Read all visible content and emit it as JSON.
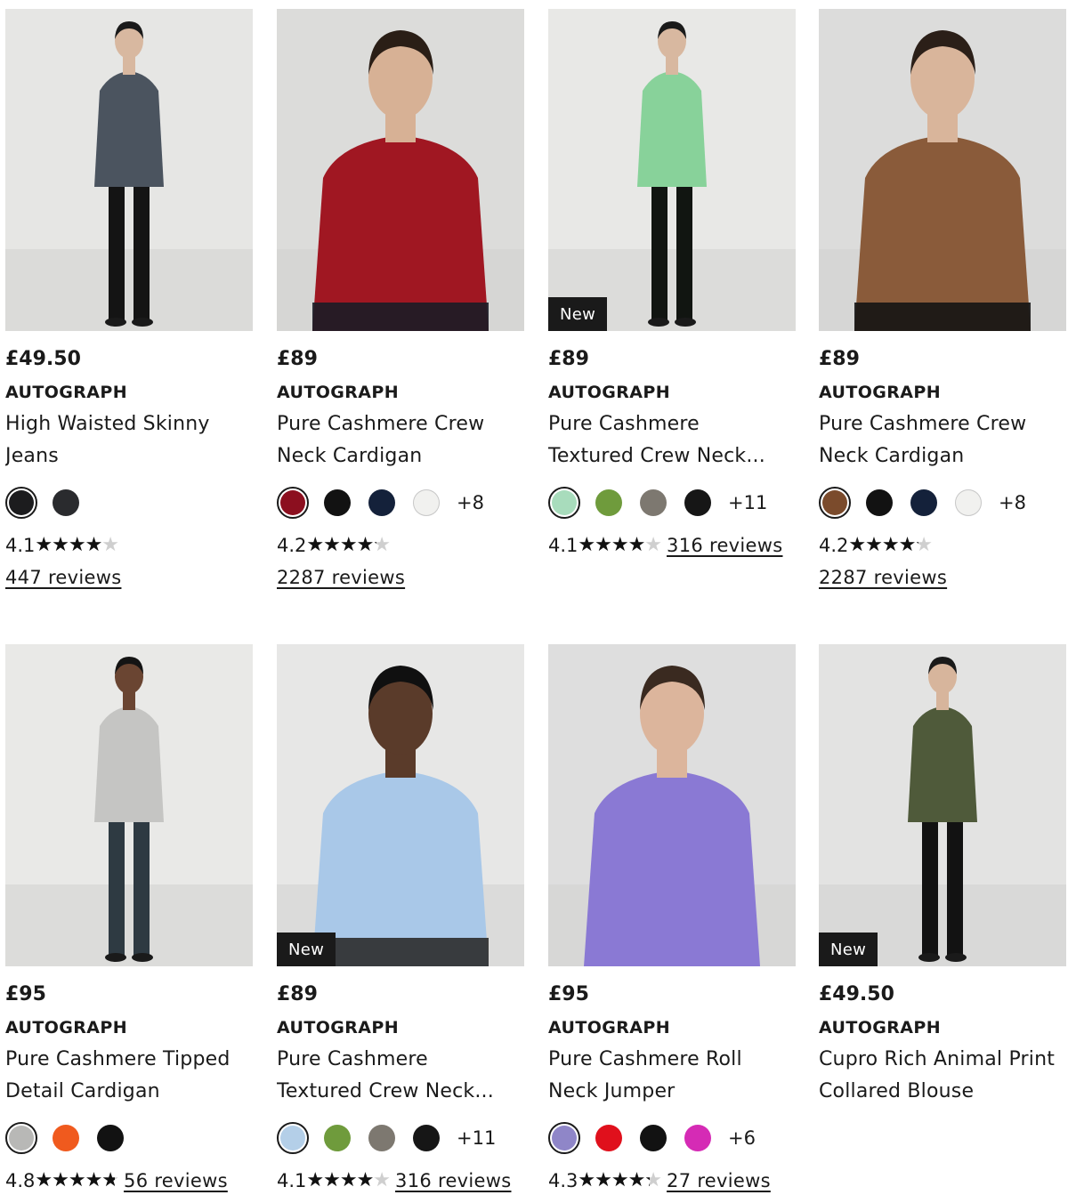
{
  "products": [
    {
      "price": "£49.50",
      "brand": "AUTOGRAPH",
      "title_line1": "High Waisted Skinny",
      "title_line2": "Jeans",
      "badge": "",
      "swatches": [
        "#1c1c1e",
        "#2a2b2e"
      ],
      "more": "",
      "rating": "4.1",
      "rating_value": 4.1,
      "reviews": "447 reviews",
      "image": {
        "bg": "#e6e6e4",
        "top": "#4b545f",
        "bottom": "#141414",
        "skin": "#d8b8a0",
        "hair": "#1a1a1a"
      }
    },
    {
      "price": "£89",
      "brand": "AUTOGRAPH",
      "title_line1": "Pure Cashmere Crew",
      "title_line2": "Neck Cardigan",
      "badge": "",
      "swatches": [
        "#8c0f1f",
        "#121212",
        "#14213a",
        "#f1f1ef"
      ],
      "more": "+8",
      "rating": "4.2",
      "rating_value": 4.2,
      "reviews": "2287 reviews",
      "image": {
        "bg": "#dcdcda",
        "top": "#a01722",
        "bottom": "#1a1c26",
        "skin": "#d7b195",
        "hair": "#2a1e16"
      }
    },
    {
      "price": "£89",
      "brand": "AUTOGRAPH",
      "title_line1": "Pure Cashmere",
      "title_line2": "Textured Crew Neck...",
      "badge": "New",
      "swatches": [
        "#a8dcbc",
        "#6f9b3c",
        "#7d7870",
        "#161616"
      ],
      "more": "+11",
      "rating": "4.1",
      "rating_value": 4.1,
      "reviews": "316 reviews",
      "image": {
        "bg": "#e8e8e6",
        "top": "#88d29a",
        "bottom": "#111511",
        "skin": "#d8b8a0",
        "hair": "#1a1a1a"
      }
    },
    {
      "price": "£89",
      "brand": "AUTOGRAPH",
      "title_line1": "Pure Cashmere Crew",
      "title_line2": "Neck Cardigan",
      "badge": "",
      "swatches": [
        "#7b4b2c",
        "#121212",
        "#14213a",
        "#f1f1ef"
      ],
      "more": "+8",
      "rating": "4.2",
      "rating_value": 4.2,
      "reviews": "2287 reviews",
      "image": {
        "bg": "#dcdcdb",
        "top": "#8a5b3a",
        "bottom": "#141414",
        "skin": "#d9b59b",
        "hair": "#2b1f18"
      }
    },
    {
      "price": "£95",
      "brand": "AUTOGRAPH",
      "title_line1": "Pure Cashmere Tipped",
      "title_line2": "Detail Cardigan",
      "badge": "",
      "swatches": [
        "#b8b8b6",
        "#f05a1e",
        "#121212"
      ],
      "more": "",
      "rating": "4.8",
      "rating_value": 4.8,
      "reviews": "56 reviews",
      "image": {
        "bg": "#e9e9e7",
        "top": "#c5c5c3",
        "bottom": "#2e3a42",
        "skin": "#6a4532",
        "hair": "#141414"
      }
    },
    {
      "price": "£89",
      "brand": "AUTOGRAPH",
      "title_line1": "Pure Cashmere",
      "title_line2": "Textured Crew Neck...",
      "badge": "New",
      "swatches": [
        "#b4cfe8",
        "#6f9b3c",
        "#7d7870",
        "#161616"
      ],
      "more": "+11",
      "rating": "4.1",
      "rating_value": 4.1,
      "reviews": "316 reviews",
      "image": {
        "bg": "#e7e7e6",
        "top": "#a9c8e8",
        "bottom": "#2b2b2b",
        "skin": "#5a3b2a",
        "hair": "#101010"
      }
    },
    {
      "price": "£95",
      "brand": "AUTOGRAPH",
      "title_line1": "Pure Cashmere Roll",
      "title_line2": "Neck Jumper",
      "badge": "",
      "swatches": [
        "#8f86c8",
        "#e0101c",
        "#121212",
        "#d52bb5"
      ],
      "more": "+6",
      "rating": "4.3",
      "rating_value": 4.3,
      "reviews": "27 reviews",
      "image": {
        "bg": "#dedede",
        "top": "#8a79d4",
        "bottom": "#8a79d4",
        "skin": "#dcb59c",
        "hair": "#3a2a20"
      }
    },
    {
      "price": "£49.50",
      "brand": "AUTOGRAPH",
      "title_line1": "Cupro Rich Animal Print",
      "title_line2": "Collared Blouse",
      "badge": "New",
      "swatches": [],
      "more": "",
      "rating": "",
      "rating_value": 0,
      "reviews": "",
      "image": {
        "bg": "#e3e3e2",
        "top": "#4f5a3a",
        "bottom": "#121212",
        "skin": "#d7b59c",
        "hair": "#1a1a1a"
      }
    }
  ]
}
